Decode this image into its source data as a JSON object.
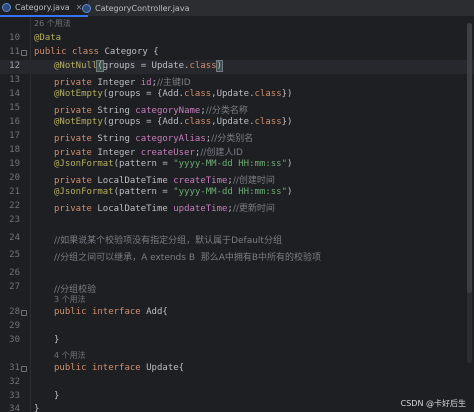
{
  "tabs": [
    {
      "label": "Category.java",
      "active": true
    },
    {
      "label": "CategoryController.java",
      "active": false
    }
  ],
  "hint_26_usages": "26 个用法",
  "lines": {
    "l10": {
      "num": "10",
      "ann": "@Data"
    },
    "l11": {
      "num": "11",
      "kw1": "public",
      "kw2": "class",
      "rest": "Category {"
    },
    "l12": {
      "num": "12",
      "ann": "@NotNull",
      "open": "(",
      "mid": "groups = Update.",
      "kw": "class",
      "close": ")"
    },
    "l13": {
      "num": "13",
      "kw": "private",
      "type": "Integer",
      "field": "id",
      "semi": ";",
      "cmt": "//主键ID"
    },
    "l14": {
      "num": "14",
      "ann": "@NotEmpty",
      "a": "(groups = {Add.",
      "kw1": "class",
      "b": ",Update.",
      "kw2": "class",
      "c": "})"
    },
    "l15": {
      "num": "15",
      "kw": "private",
      "type": "String",
      "field": "categoryName",
      "semi": ";",
      "cmt": "//分类名称"
    },
    "l16": {
      "num": "16",
      "ann": "@NotEmpty",
      "a": "(groups = {Add.",
      "kw1": "class",
      "b": ",Update.",
      "kw2": "class",
      "c": "})"
    },
    "l17": {
      "num": "17",
      "kw": "private",
      "type": "String",
      "field": "categoryAlias",
      "semi": ";",
      "cmt": "//分类别名"
    },
    "l18": {
      "num": "18",
      "kw": "private",
      "type": "Integer",
      "field": "createUser",
      "semi": ";",
      "cmt": "//创建人ID"
    },
    "l19": {
      "num": "19",
      "ann": "@JsonFormat",
      "a": "(pattern = ",
      "str": "\"yyyy-MM-dd HH:mm:ss\"",
      "c": ")"
    },
    "l20": {
      "num": "20",
      "kw": "private",
      "type": "LocalDateTime",
      "field": "createTime",
      "semi": ";",
      "cmt": "//创建时间"
    },
    "l21": {
      "num": "21",
      "ann": "@JsonFormat",
      "a": "(pattern = ",
      "str": "\"yyyy-MM-dd HH:mm:ss\"",
      "c": ")"
    },
    "l22": {
      "num": "22",
      "kw": "private",
      "type": "LocalDateTime",
      "field": "updateTime",
      "semi": ";",
      "cmt": "//更新时间"
    },
    "l23": {
      "num": "23"
    },
    "l24": {
      "num": "24",
      "cmt": "//如果说某个校验项没有指定分组，默认属于Default分组"
    },
    "l25": {
      "num": "25",
      "cmt": "//分组之间可以继承，A extends B  那么A中拥有B中所有的校验项"
    },
    "l26": {
      "num": "26"
    },
    "l27": {
      "num": "27",
      "cmt": "//分组校验"
    },
    "hint3": "3 个用法",
    "l28": {
      "num": "28",
      "kw1": "public",
      "kw2": "interface",
      "rest": "Add{"
    },
    "l29": {
      "num": "29"
    },
    "l30": {
      "num": "30",
      "rest": "}"
    },
    "hint4": "4 个用法",
    "l31": {
      "num": "31",
      "kw1": "public",
      "kw2": "interface",
      "rest": "Update{"
    },
    "l32": {
      "num": "32"
    },
    "l33": {
      "num": "33",
      "rest": "}"
    },
    "l34": {
      "num": "34",
      "rest": "}"
    }
  },
  "watermark": "CSDN @卡好后生",
  "colors": {
    "background": "#1e1f22",
    "keyword": "#cf8e6d",
    "annotation": "#b3ae60",
    "field": "#c77dbb",
    "string": "#6aab73",
    "comment": "#7a7e85"
  }
}
